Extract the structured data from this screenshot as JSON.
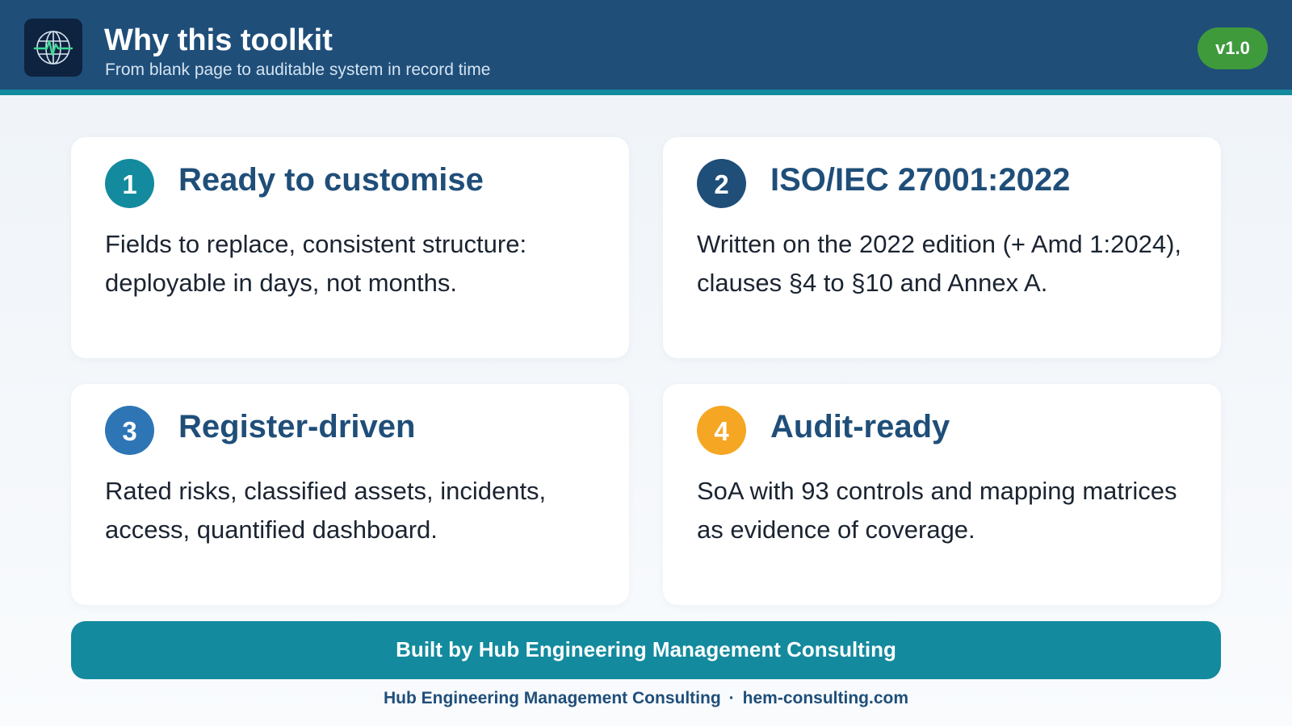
{
  "header": {
    "title": "Why this toolkit",
    "subtitle": "From blank page to auditable system in record time",
    "version": "v1.0",
    "logo_icon": "globe-pulse-icon"
  },
  "colors": {
    "header_bg": "#1f4e79",
    "accent_teal": "#138a9e",
    "badge_green": "#3f9a3c",
    "num_1": "#138a9e",
    "num_2": "#1f4e79",
    "num_3": "#2e75b6",
    "num_4": "#f5a623"
  },
  "cards": [
    {
      "number": "1",
      "title": "Ready to customise",
      "text": "Fields to replace, consistent structure: deployable in days, not months."
    },
    {
      "number": "2",
      "title": "ISO/IEC 27001:2022",
      "text": "Written on the 2022 edition (+ Amd 1:2024), clauses §4 to §10 and Annex A."
    },
    {
      "number": "3",
      "title": "Register-driven",
      "text": "Rated risks, classified assets, incidents, access, quantified dashboard."
    },
    {
      "number": "4",
      "title": "Audit-ready",
      "text": "SoA with 93 controls and mapping matrices as evidence of coverage."
    }
  ],
  "banner": {
    "text": "Built by Hub Engineering Management Consulting"
  },
  "footer": {
    "company": "Hub Engineering Management Consulting",
    "separator": "·",
    "website": "hem-consulting.com"
  }
}
